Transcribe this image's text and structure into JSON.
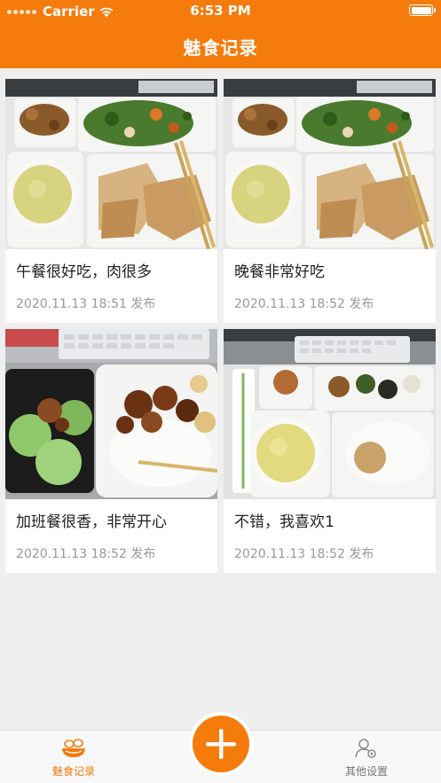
{
  "status_bar": {
    "carrier": "Carrier",
    "time": "6:53 PM"
  },
  "header": {
    "title": "魅食记录"
  },
  "posts": [
    {
      "caption": "午餐很好吃，肉很多",
      "date": "2020.11.13 18:51 发布"
    },
    {
      "caption": "晚餐非常好吃",
      "date": "2020.11.13 18:52 发布"
    },
    {
      "caption": "加班餐很香，非常开心",
      "date": "2020.11.13 18:52 发布"
    },
    {
      "caption": "不错，我喜欢1",
      "date": "2020.11.13 18:52 发布"
    }
  ],
  "tabbar": {
    "home_label": "魅食记录",
    "settings_label": "其他设置",
    "add_icon": "plus-icon"
  },
  "colors": {
    "accent": "#f57b0c",
    "background": "#efefef"
  }
}
